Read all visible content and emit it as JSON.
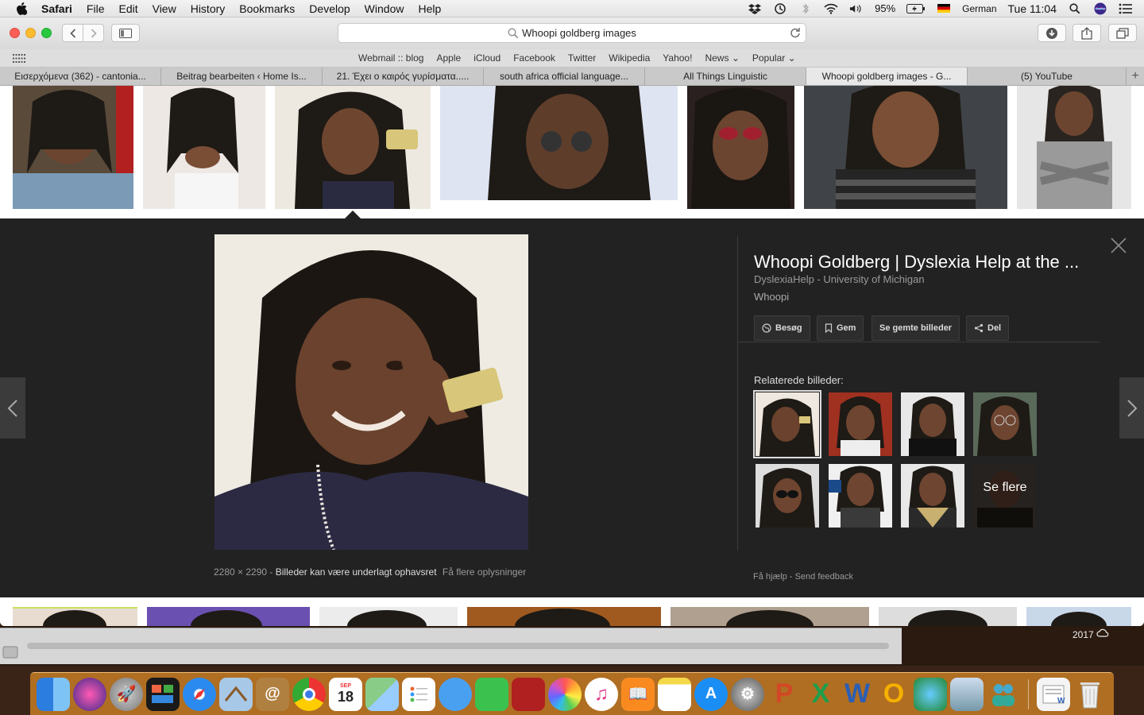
{
  "menubar": {
    "app_name": "Safari",
    "menus": [
      "File",
      "Edit",
      "View",
      "History",
      "Bookmarks",
      "Develop",
      "Window",
      "Help"
    ],
    "battery": "95%",
    "input_language": "German",
    "clock": "Tue 11:04"
  },
  "toolbar": {
    "address": "Whoopi goldberg images"
  },
  "favorites": [
    "Webmail :: blog",
    "Apple",
    "iCloud",
    "Facebook",
    "Twitter",
    "Wikipedia",
    "Yahoo!",
    "News",
    "Popular"
  ],
  "tabs": [
    "Εισερχόμενα (362) - cantonia...",
    "Beitrag bearbeiten ‹ Home Is...",
    "21. Έχει ο καιρός γυρίσματα.....",
    "south africa official language...",
    "All Things Linguistic",
    "Whoopi goldberg images - G...",
    "(5) YouTube"
  ],
  "detail": {
    "title": "Whoopi Goldberg | Dyslexia Help at the ...",
    "source": "DyslexiaHelp - University of Michigan",
    "description": "Whoopi",
    "actions": {
      "visit": "Besøg",
      "save": "Gem",
      "saved": "Se gemte billeder",
      "share": "Del"
    },
    "related_heading": "Relaterede billeder:",
    "see_more": "Se flere",
    "image_dimensions": "2280 × 2290",
    "copyright_notice": "Billeder kan være underlagt ophavsret",
    "more_info": "Få flere oplysninger",
    "help": "Få hjælp",
    "feedback": "Send feedback"
  },
  "desktop": {
    "year_label": "2017"
  },
  "dock": {
    "calendar_month": "SEP",
    "calendar_day": "18"
  },
  "colors": {
    "detail_bg": "#222222",
    "menubar_bg": "#ececec",
    "dock_tint": "#f0962a"
  }
}
